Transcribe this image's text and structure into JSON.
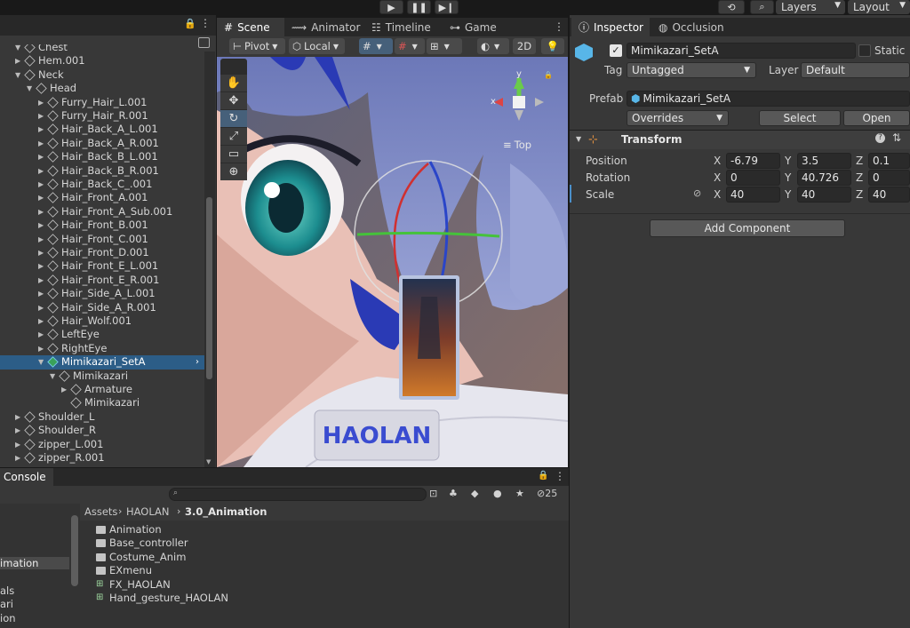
{
  "toolbar": {
    "play_icon": "play-icon",
    "pause_icon": "pause-icon",
    "step_icon": "step-icon",
    "layers_label": "Layers",
    "layout_label": "Layout"
  },
  "hierarchy": {
    "rows": [
      {
        "label": "Chest",
        "depth": 1,
        "arrow": "down"
      },
      {
        "label": "Hem.001",
        "depth": 1,
        "arrow": "right"
      },
      {
        "label": "Neck",
        "depth": 1,
        "arrow": "down"
      },
      {
        "label": "Head",
        "depth": 2,
        "arrow": "down"
      },
      {
        "label": "Furry_Hair_L.001",
        "depth": 3,
        "arrow": "right"
      },
      {
        "label": "Furry_Hair_R.001",
        "depth": 3,
        "arrow": "right"
      },
      {
        "label": "Hair_Back_A_L.001",
        "depth": 3,
        "arrow": "right"
      },
      {
        "label": "Hair_Back_A_R.001",
        "depth": 3,
        "arrow": "right"
      },
      {
        "label": "Hair_Back_B_L.001",
        "depth": 3,
        "arrow": "right"
      },
      {
        "label": "Hair_Back_B_R.001",
        "depth": 3,
        "arrow": "right"
      },
      {
        "label": "Hair_Back_C_.001",
        "depth": 3,
        "arrow": "right"
      },
      {
        "label": "Hair_Front_A.001",
        "depth": 3,
        "arrow": "right"
      },
      {
        "label": "Hair_Front_A_Sub.001",
        "depth": 3,
        "arrow": "right"
      },
      {
        "label": "Hair_Front_B.001",
        "depth": 3,
        "arrow": "right"
      },
      {
        "label": "Hair_Front_C.001",
        "depth": 3,
        "arrow": "right"
      },
      {
        "label": "Hair_Front_D.001",
        "depth": 3,
        "arrow": "right"
      },
      {
        "label": "Hair_Front_E_L.001",
        "depth": 3,
        "arrow": "right"
      },
      {
        "label": "Hair_Front_E_R.001",
        "depth": 3,
        "arrow": "right"
      },
      {
        "label": "Hair_Side_A_L.001",
        "depth": 3,
        "arrow": "right"
      },
      {
        "label": "Hair_Side_A_R.001",
        "depth": 3,
        "arrow": "right"
      },
      {
        "label": "Hair_Wolf.001",
        "depth": 3,
        "arrow": "right"
      },
      {
        "label": "LeftEye",
        "depth": 3,
        "arrow": "right"
      },
      {
        "label": "RightEye",
        "depth": 3,
        "arrow": "right"
      },
      {
        "label": "Mimikazari_SetA",
        "depth": 3,
        "arrow": "down",
        "selected": true,
        "prefab": true
      },
      {
        "label": "Mimikazari",
        "depth": 4,
        "arrow": "down"
      },
      {
        "label": "Armature",
        "depth": 5,
        "arrow": "right"
      },
      {
        "label": "Mimikazari",
        "depth": 5,
        "arrow": "none"
      },
      {
        "label": "Shoulder_L",
        "depth": 1,
        "arrow": "right"
      },
      {
        "label": "Shoulder_R",
        "depth": 1,
        "arrow": "right"
      },
      {
        "label": "zipper_L.001",
        "depth": 1,
        "arrow": "right"
      },
      {
        "label": "zipper_R.001",
        "depth": 1,
        "arrow": "right"
      }
    ]
  },
  "scene": {
    "tabs": [
      "Scene",
      "Animator",
      "Timeline",
      "Game"
    ],
    "pivot_label": "Pivot",
    "local_label": "Local",
    "mode_2d_label": "2D",
    "gizmo_top_label": "Top",
    "axis_x": "x",
    "axis_y": "y",
    "badge_text": "HAOLAN"
  },
  "inspector": {
    "tabs": [
      "Inspector",
      "Occlusion"
    ],
    "object_name": "Mimikazari_SetA",
    "static_label": "Static",
    "tag_label": "Tag",
    "tag_value": "Untagged",
    "layer_label": "Layer",
    "layer_value": "Default",
    "prefab_label": "Prefab",
    "prefab_value": "Mimikazari_SetA",
    "overrides_label": "Overrides",
    "select_label": "Select",
    "open_label": "Open",
    "transform_title": "Transform",
    "position_label": "Position",
    "rotation_label": "Rotation",
    "scale_label": "Scale",
    "x": "X",
    "y": "Y",
    "z": "Z",
    "position": [
      "-6.79",
      "3.5",
      "0.1"
    ],
    "rotation": [
      "0",
      "40.726",
      "0"
    ],
    "scale": [
      "40",
      "40",
      "40"
    ],
    "add_component_label": "Add Component"
  },
  "console": {
    "title": "Console",
    "count": "25"
  },
  "project": {
    "breadcrumb": [
      "Assets",
      "HAOLAN",
      "3.0_Animation"
    ],
    "items": [
      {
        "label": "Animation",
        "kind": "folder"
      },
      {
        "label": "Base_controller",
        "kind": "folder"
      },
      {
        "label": "Costume_Anim",
        "kind": "folder"
      },
      {
        "label": "EXmenu",
        "kind": "folder"
      },
      {
        "label": "FX_HAOLAN",
        "kind": "controller"
      },
      {
        "label": "Hand_gesture_HAOLAN",
        "kind": "controller"
      }
    ],
    "left_items": [
      "imation",
      "als",
      "ari",
      "ion"
    ]
  }
}
